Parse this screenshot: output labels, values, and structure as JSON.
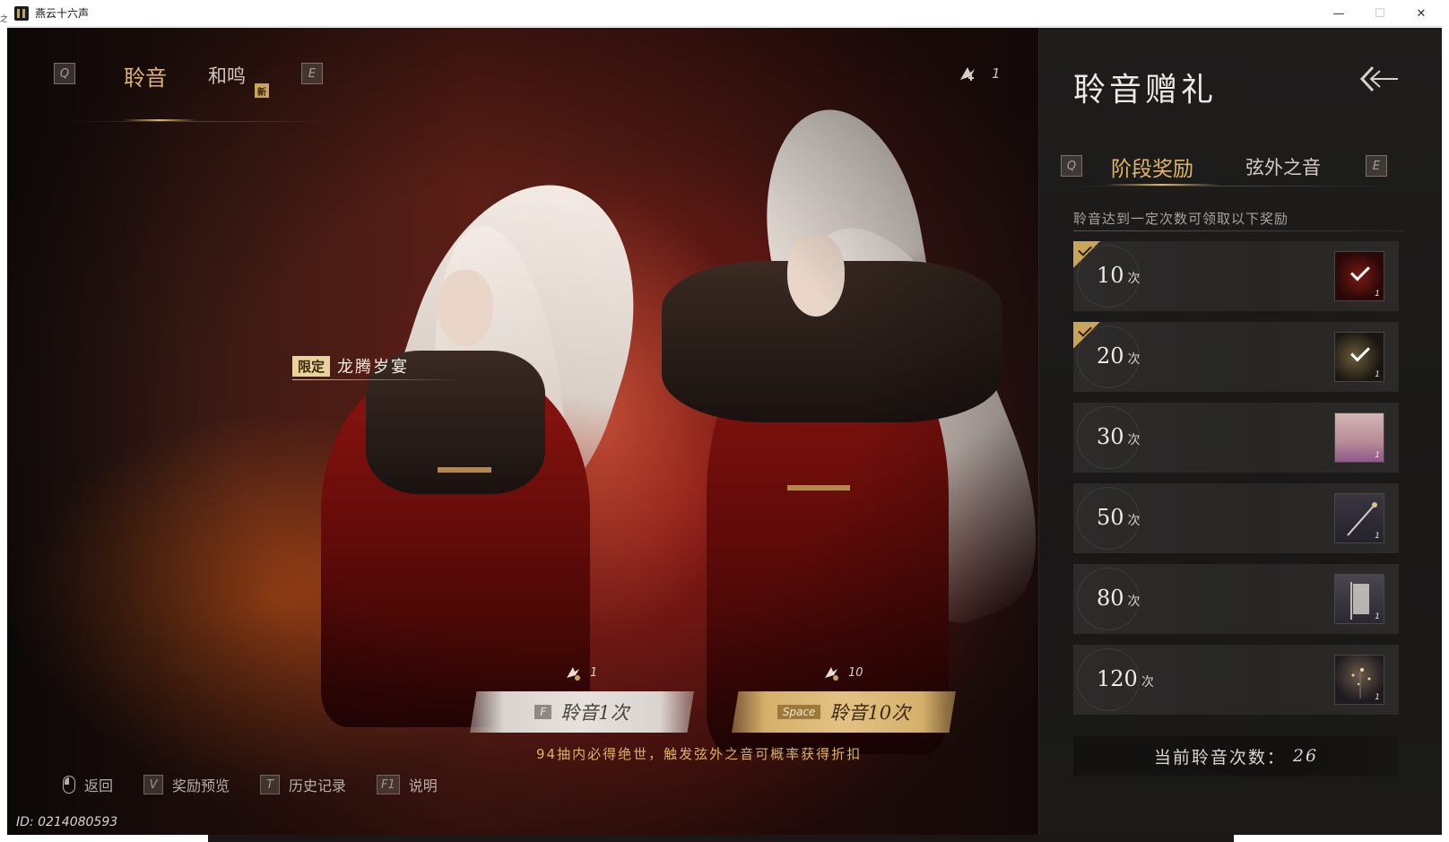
{
  "window": {
    "title": "燕云十六声",
    "outer_glyph": "之",
    "minimize_glyph": "—",
    "maximize_glyph": "☐",
    "close_glyph": "✕"
  },
  "stage": {
    "tab_prev_key": "Q",
    "tab_next_key": "E",
    "tabs": [
      {
        "label": "聆音",
        "active": true
      },
      {
        "label": "和鸣",
        "active": false,
        "badge": "新"
      }
    ],
    "currency_count": "1",
    "limited_tag": "限定",
    "limited_name": "龙腾岁宴",
    "pull_one": {
      "key": "F",
      "label": "聆音1次",
      "cost": "1"
    },
    "pull_ten": {
      "key": "Space",
      "label": "聆音10次",
      "cost": "10"
    },
    "guarantee_text": "94抽内必得绝世，触发弦外之音可概率获得折扣",
    "hotkeys": [
      {
        "key": "mouse",
        "label": "返回"
      },
      {
        "key": "V",
        "label": "奖励预览"
      },
      {
        "key": "T",
        "label": "历史记录"
      },
      {
        "key": "F1",
        "label": "说明"
      }
    ],
    "player_id": "ID: 0214080593"
  },
  "panel": {
    "title": "聆音赠礼",
    "sub_prev_key": "Q",
    "sub_next_key": "E",
    "sub_tabs": [
      {
        "label": "阶段奖励",
        "active": true
      },
      {
        "label": "弦外之音",
        "active": false
      }
    ],
    "description": "聆音达到一定次数可领取以下奖励",
    "milestones": [
      {
        "count": "10",
        "unit": "次",
        "claimed": true,
        "qty": "1"
      },
      {
        "count": "20",
        "unit": "次",
        "claimed": true,
        "qty": "1"
      },
      {
        "count": "30",
        "unit": "次",
        "claimed": false,
        "qty": "1"
      },
      {
        "count": "50",
        "unit": "次",
        "claimed": false,
        "qty": "1"
      },
      {
        "count": "80",
        "unit": "次",
        "claimed": false,
        "qty": "1"
      },
      {
        "count": "120",
        "unit": "次",
        "claimed": false,
        "qty": "1"
      }
    ],
    "current_label": "当前聆音次数：",
    "current_value": "26"
  },
  "colors": {
    "accent_gold": "#e1b56a",
    "panel_bg": "#1e1d1c",
    "banner_red": "#8e1410"
  }
}
